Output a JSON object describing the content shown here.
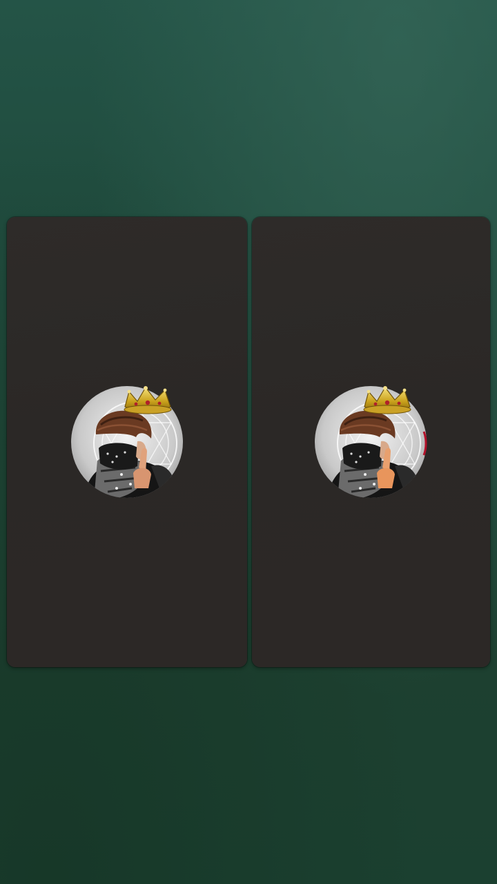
{
  "screen": {
    "background_colors": [
      "#245447",
      "#1d4030"
    ],
    "panel_color": "#2c2927"
  },
  "panels": [
    {
      "id": "left",
      "avatar_icon": "profile-avatar-crowned-man-icon"
    },
    {
      "id": "right",
      "avatar_icon": "profile-avatar-crowned-man-icon"
    }
  ]
}
